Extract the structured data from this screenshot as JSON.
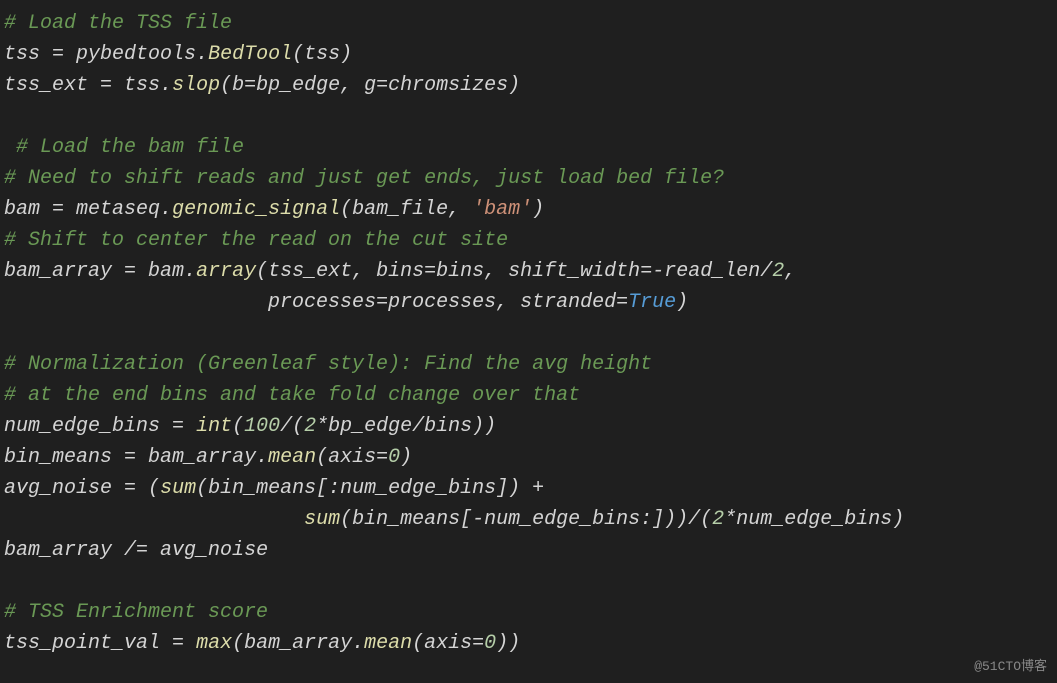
{
  "watermark": "@51CTO博客",
  "lines": {
    "l1_c": "# Load the TSS file",
    "l2_a": "tss ",
    "l2_eq": "=",
    "l2_b": " pybedtools",
    "l2_dot": ".",
    "l2_fn": "BedTool",
    "l2_c": "(tss)",
    "l3_a": "tss_ext ",
    "l3_eq": "=",
    "l3_b": " tss",
    "l3_dot": ".",
    "l3_fn": "slop",
    "l3_c": "(b",
    "l3_eq2": "=",
    "l3_d": "bp_edge, g",
    "l3_eq3": "=",
    "l3_e": "chromsizes)",
    "l4": "",
    "l5_c": " # Load the bam file",
    "l6_c": "# Need to shift reads and just get ends, just load bed file?",
    "l7_a": "bam ",
    "l7_eq": "=",
    "l7_b": " metaseq",
    "l7_dot": ".",
    "l7_fn": "genomic_signal",
    "l7_c": "(bam_file, ",
    "l7_s": "'bam'",
    "l7_d": ")",
    "l8_c": "# Shift to center the read on the cut site",
    "l9_a": "bam_array ",
    "l9_eq": "=",
    "l9_b": " bam",
    "l9_dot": ".",
    "l9_fn": "array",
    "l9_c": "(tss_ext, bins",
    "l9_eq2": "=",
    "l9_d": "bins, shift_width",
    "l9_eq3": "=-",
    "l9_e": "read_len",
    "l9_div": "/",
    "l9_n": "2",
    "l9_f": ",",
    "l10_pad": "                      ",
    "l10_a": "processes",
    "l10_eq": "=",
    "l10_b": "processes, stranded",
    "l10_eq2": "=",
    "l10_true": "True",
    "l10_c": ")",
    "l11": "",
    "l12_c": "# Normalization (Greenleaf style): Find the avg height",
    "l13_c": "# at the end bins and take fold change over that",
    "l14_a": "num_edge_bins ",
    "l14_eq": "=",
    "l14_sp": " ",
    "l14_int": "int",
    "l14_b": "(",
    "l14_n1": "100",
    "l14_c": "/(",
    "l14_n2": "2",
    "l14_d": "*bp_edge/bins))",
    "l15_a": "bin_means ",
    "l15_eq": "=",
    "l15_b": " bam_array",
    "l15_dot": ".",
    "l15_fn": "mean",
    "l15_c": "(axis",
    "l15_eq2": "=",
    "l15_n": "0",
    "l15_d": ")",
    "l16_a": "avg_noise ",
    "l16_eq": "=",
    "l16_b": " (",
    "l16_sum": "sum",
    "l16_c": "(bin_means[:num_edge_bins]) ",
    "l16_plus": "+",
    "l17_pad": "                         ",
    "l17_sum": "sum",
    "l17_a": "(bin_means[",
    "l17_neg": "-",
    "l17_b": "num_edge_bins:]))/(",
    "l17_n": "2",
    "l17_c": "*num_edge_bins)",
    "l18_a": "bam_array ",
    "l18_op": "/=",
    "l18_b": " avg_noise",
    "l19": "",
    "l20_c": "# TSS Enrichment score",
    "l21_a": "tss_point_val ",
    "l21_eq": "=",
    "l21_sp": " ",
    "l21_max": "max",
    "l21_b": "(bam_array",
    "l21_dot": ".",
    "l21_fn": "mean",
    "l21_c": "(axis",
    "l21_eq2": "=",
    "l21_n": "0",
    "l21_d": "))"
  }
}
